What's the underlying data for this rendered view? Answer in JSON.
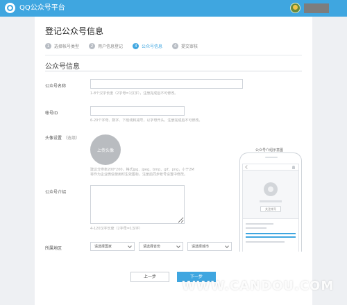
{
  "topbar": {
    "brand_name": "QQ公众号平台",
    "brand_color": "#3fa6e0"
  },
  "page": {
    "title": "登记公众号信息",
    "steps": [
      {
        "num": "1",
        "label": "选择帐号类型"
      },
      {
        "num": "2",
        "label": "用户信息登记"
      },
      {
        "num": "3",
        "label": "公众号信息"
      },
      {
        "num": "4",
        "label": "提交审核"
      }
    ],
    "active_step": 3
  },
  "form": {
    "section_title": "公众号信息",
    "name": {
      "label": "公众号名称",
      "value": "",
      "hint": "1-8个汉字长度（2字母=1汉字），注册完成后不可修改。"
    },
    "account_id": {
      "label": "帐号ID",
      "value": "",
      "hint": "6-20个字母、数字、下划线和减号，以字母开头，注册完成后不可修改。"
    },
    "avatar": {
      "label": "头像设置",
      "optional": "（选填）",
      "upload_label": "上传头像",
      "hint_line1": "建议分辨率200*200，格式jpg、jpeg、bmp、gif、png，小于2M",
      "hint_line2": "将作为企业微信使用时生效图标，注册后同步帐号设置中修改。"
    },
    "intro": {
      "label": "公众号介绍",
      "value": "",
      "hint": "4-120汉字长度（2字母=1汉字）"
    },
    "region": {
      "label": "所属地区",
      "country": "请选择国家",
      "province": "请选择省份",
      "city": "请选择城市"
    }
  },
  "preview": {
    "title": "公众号介绍示意图",
    "follow_label": "关注帐号"
  },
  "buttons": {
    "prev": "上一步",
    "next": "下一步"
  },
  "watermark": "WWW.CANDOU.COM"
}
